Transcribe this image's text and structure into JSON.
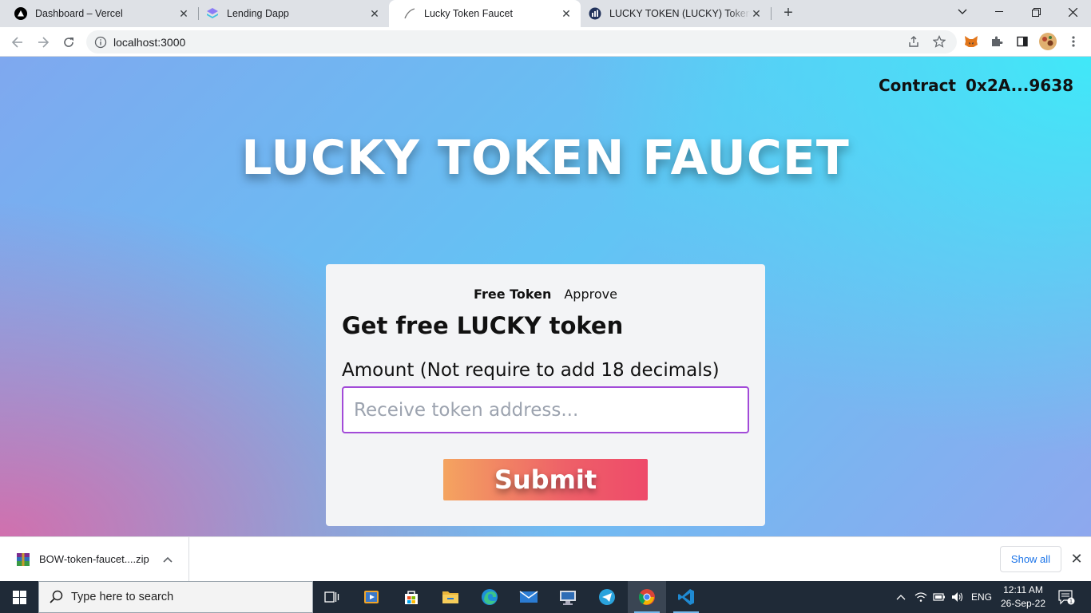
{
  "browser": {
    "tabs": [
      {
        "title": "Dashboard – Vercel",
        "icon": "vercel-icon",
        "active": false
      },
      {
        "title": "Lending Dapp",
        "icon": "layers-icon",
        "active": false
      },
      {
        "title": "Lucky Token Faucet",
        "icon": "loading-icon",
        "active": true
      },
      {
        "title": "LUCKY TOKEN (LUCKY) Token Tra",
        "icon": "bscscan-icon",
        "active": false
      }
    ],
    "new_tab": "+",
    "url": "localhost:3000"
  },
  "header": {
    "contract_label": "Contract",
    "contract_address": "0x2A...9638"
  },
  "hero": {
    "title": "LUCKY TOKEN FAUCET"
  },
  "card": {
    "tabs": [
      {
        "label": "Free Token",
        "active": true
      },
      {
        "label": "Approve",
        "active": false
      }
    ],
    "heading": "Get free LUCKY token",
    "amount_label": "Amount (Not require to add 18 decimals)",
    "address_value": "",
    "address_placeholder": "Receive token address...",
    "submit_label": "Submit"
  },
  "downloads": {
    "file_name": "BOW-token-faucet....zip",
    "show_all": "Show all"
  },
  "taskbar": {
    "search_placeholder": "Type here to search",
    "language": "ENG",
    "time": "12:11 AM",
    "date": "26-Sep-22",
    "notification_count": "1"
  },
  "colors": {
    "input_border": "#a24bd8",
    "submit_gradient_start": "#f4a460",
    "submit_gradient_end": "#ee4a6a",
    "link_blue": "#1a73e8"
  }
}
